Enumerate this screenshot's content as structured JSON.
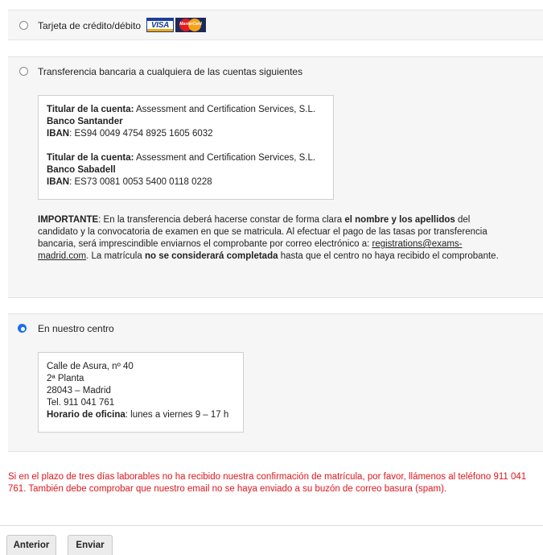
{
  "payment_options": {
    "card": {
      "label": "Tarjeta de crédito/débito",
      "selected": false,
      "visa_text": "VISA",
      "mastercard_text": "MasterCard"
    },
    "transfer": {
      "label": "Transferencia bancaria a cualquiera de las cuentas siguientes",
      "selected": false,
      "accounts": [
        {
          "holder_label": "Titular de la cuenta:",
          "holder_value": "Assessment and Certification Services, S.L.",
          "bank": "Banco Santander",
          "iban_label": "IBAN",
          "iban_value": ": ES94 0049 4754 8925 1605 6032"
        },
        {
          "holder_label": "Titular de la cuenta:",
          "holder_value": "Assessment and Certification Services, S.L.",
          "bank": "Banco Sabadell",
          "iban_label": "IBAN",
          "iban_value": ": ES73 0081 0053 5400 0118 0228"
        }
      ],
      "important": {
        "label": "IMPORTANTE",
        "t1": ": En la transferencia deberá hacerse constar de forma clara ",
        "b1": "el nombre y los apellidos",
        "t2": " del candidato y la convocatoria de examen en que se matricula. Al efectuar el pago de las tasas por transferencia bancaria, será imprescindible enviarnos el comprobante por correo electrónico a: ",
        "email": "registrations@exams-madrid.com",
        "t3": ". La matrícula ",
        "b2": "no se considerará completada",
        "t4": " hasta que el centro no haya recibido el comprobante."
      }
    },
    "center": {
      "label": "En nuestro centro",
      "selected": true,
      "address_line1": "Calle de Asura, nº 40",
      "address_line2": "2ª Planta",
      "address_line3": "28043 – Madrid",
      "phone": "Tel. 911 041 761",
      "hours_label": "Horario de oficina",
      "hours_value": ": lunes a viernes 9 – 17 h"
    }
  },
  "warning_text": "Si en el plazo de tres días laborables no ha recibido nuestra confirmación de matrícula, por favor, llámenos al teléfono 911 041 761. También debe comprobar que nuestro email no se haya enviado a su buzón de correo basura (spam).",
  "buttons": {
    "previous": "Anterior",
    "submit": "Enviar"
  },
  "colors": {
    "warning": "#e0161c",
    "radio_selected": "#1a6fe8",
    "panel_bg": "#f6f6f6"
  }
}
